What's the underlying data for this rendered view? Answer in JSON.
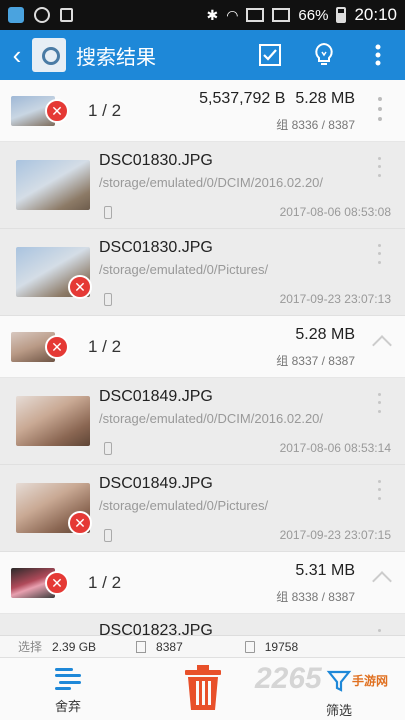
{
  "status_bar": {
    "battery": "66%",
    "time": "20:10"
  },
  "app_bar": {
    "title": "搜索结果"
  },
  "groups": [
    {
      "count": "1 / 2",
      "bytes": "5,537,792 B",
      "size": "5.28 MB",
      "group_id": "组 8336 / 8387",
      "files": [
        {
          "name": "DSC01830.JPG",
          "path": "/storage/emulated/0/DCIM/2016.02.20/",
          "date": "2017-08-06 08:53:08"
        },
        {
          "name": "DSC01830.JPG",
          "path": "/storage/emulated/0/Pictures/",
          "date": "2017-09-23 23:07:13"
        }
      ]
    },
    {
      "count": "1 / 2",
      "size": "5.28 MB",
      "group_id": "组 8337 / 8387",
      "files": [
        {
          "name": "DSC01849.JPG",
          "path": "/storage/emulated/0/DCIM/2016.02.20/",
          "date": "2017-08-06 08:53:14"
        },
        {
          "name": "DSC01849.JPG",
          "path": "/storage/emulated/0/Pictures/",
          "date": "2017-09-23 23:07:15"
        }
      ]
    },
    {
      "count": "1 / 2",
      "size": "5.31 MB",
      "group_id": "组 8338 / 8387",
      "files": [
        {
          "name": "DSC01823.JPG"
        }
      ]
    }
  ],
  "info_bar": {
    "selected_label": "选择",
    "selected_size": "2.39 GB",
    "groups_total": "8387",
    "files_total": "19758"
  },
  "bottom_bar": {
    "abandon_label": "舍弃",
    "filter_label": "筛选"
  },
  "watermark": {
    "main": "2265",
    "sub": "手游网"
  },
  "colors": {
    "accent": "#1e88d8",
    "delete_badge": "#e53935",
    "trash": "#e8502a"
  }
}
